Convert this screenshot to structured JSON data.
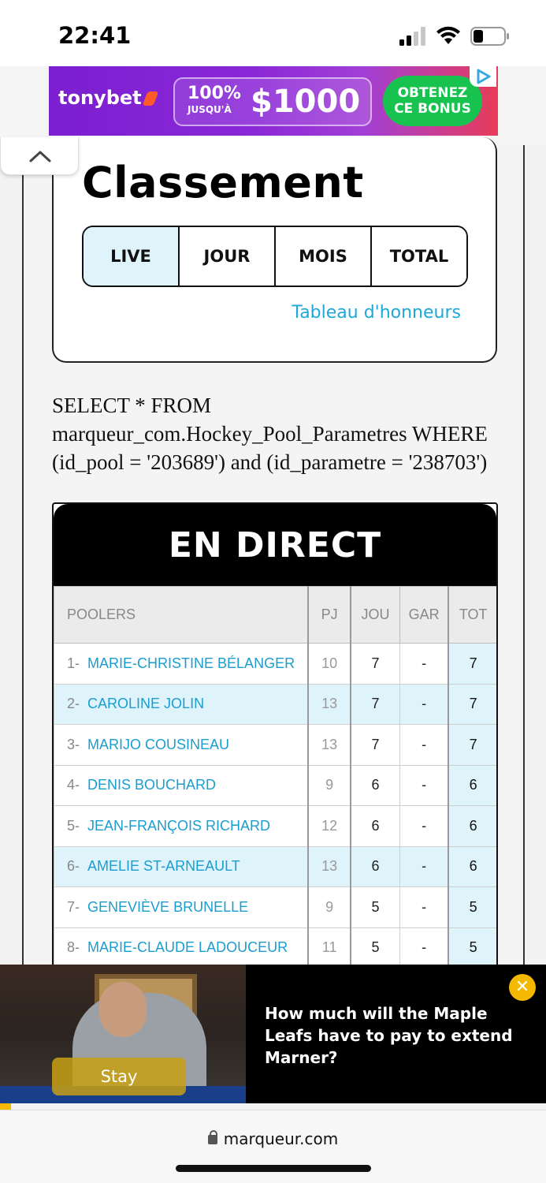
{
  "status_bar": {
    "time": "22:41"
  },
  "ad_banner": {
    "brand": "tonybet",
    "percent": "100%",
    "up_to": "JUSQU'À",
    "amount": "$1000",
    "cta_line1": "OBTENEZ",
    "cta_line2": "CE BONUS"
  },
  "classement": {
    "title": "Classement",
    "tabs": [
      {
        "label": "LIVE",
        "active": true
      },
      {
        "label": "JOUR"
      },
      {
        "label": "MOIS"
      },
      {
        "label": "TOTAL"
      }
    ],
    "honor_link": "Tableau d'honneurs"
  },
  "sql_debug": "SELECT * FROM marqueur_com.Hockey_Pool_Parametres WHERE (id_pool = '203689') and (id_parametre = '238703')",
  "live_table": {
    "title": "EN DIRECT",
    "headers": {
      "poolers": "POOLERS",
      "pj": "PJ",
      "jou": "JOU",
      "gar": "GAR",
      "tot": "TOT"
    },
    "rows": [
      {
        "rank": "1-",
        "name": "MARIE-CHRISTINE BÉLANGER",
        "pj": "10",
        "jou": "7",
        "gar": "-",
        "tot": "7"
      },
      {
        "rank": "2-",
        "name": "CAROLINE JOLIN",
        "pj": "13",
        "jou": "7",
        "gar": "-",
        "tot": "7"
      },
      {
        "rank": "3-",
        "name": "MARIJO COUSINEAU",
        "pj": "13",
        "jou": "7",
        "gar": "-",
        "tot": "7"
      },
      {
        "rank": "4-",
        "name": "DENIS BOUCHARD",
        "pj": "9",
        "jou": "6",
        "gar": "-",
        "tot": "6"
      },
      {
        "rank": "5-",
        "name": "JEAN-FRANÇOIS RICHARD",
        "pj": "12",
        "jou": "6",
        "gar": "-",
        "tot": "6"
      },
      {
        "rank": "6-",
        "name": "AMELIE ST-ARNEAULT",
        "pj": "13",
        "jou": "6",
        "gar": "-",
        "tot": "6"
      },
      {
        "rank": "7-",
        "name": "GENEVIÈVE BRUNELLE",
        "pj": "9",
        "jou": "5",
        "gar": "-",
        "tot": "5"
      },
      {
        "rank": "8-",
        "name": "MARIE-CLAUDE LADOUCEUR",
        "pj": "11",
        "jou": "5",
        "gar": "-",
        "tot": "5"
      }
    ]
  },
  "video_ad": {
    "stay_label": "Stay",
    "headline": "How much will the Maple Leafs have to pay to extend Marner?",
    "close_icon": "close-icon"
  },
  "url_bar": {
    "url": "marqueur.com"
  },
  "colors": {
    "accent_blue": "#1da8d8",
    "highlight": "#dff3fb",
    "ad_close": "#f5b800"
  }
}
